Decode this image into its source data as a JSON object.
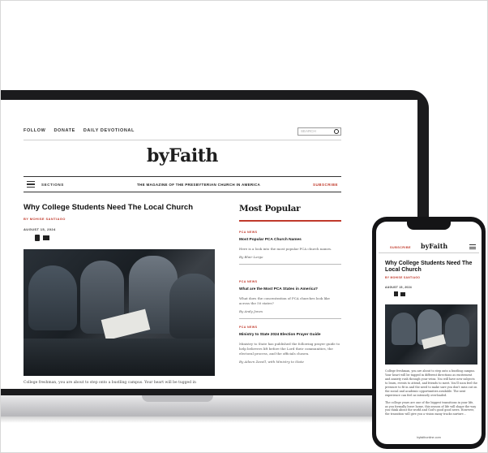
{
  "laptop": {
    "top_links": [
      "FOLLOW",
      "DONATE",
      "DAILY DEVOTIONAL"
    ],
    "search_placeholder": "SEARCH",
    "logo": "byFaith",
    "nav": {
      "sections_label": "SECTIONS",
      "tagline": "THE MAGAZINE OF THE PRESBYTERIAN CHURCH IN AMERICA",
      "subscribe_label": "SUBSCRIBE"
    },
    "article": {
      "title": "Why College Students Need The Local Church",
      "byline": "BY MOHISE SANTIAGO",
      "date": "AUGUST 15, 2024",
      "body_excerpt": "College freshman, you are about to step onto a bustling campus. Your heart will be tugged in"
    },
    "popular": {
      "heading": "Most Popular",
      "items": [
        {
          "tag": "PCA NEWS",
          "title": "Most Popular PCA Church Names",
          "text": "Here is a look into the most popular PCA church names.",
          "author": "By Blair Largo"
        },
        {
          "tag": "PCA NEWS",
          "title": "What are the Most PCA States in America?",
          "text": "What does the concentration of PCA churches look like across the 50 states?",
          "author": "By Andy Jones"
        },
        {
          "tag": "PCA NEWS",
          "title": "Ministry to State 2024 Election Prayer Guide",
          "text": "Ministry to State has published the following prayer guide to help believers lift before the Lord their communities, the electoral process, and the officials chosen.",
          "author": "By Aileen Zavell, with Ministry to State"
        }
      ]
    }
  },
  "phone": {
    "subscribe_label": "SUBSCRIBE",
    "logo": "byFaith",
    "title": "Why College Students Need The Local Church",
    "byline": "BY MOHISE SANTIAGO",
    "date": "AUGUST 15, 2024",
    "paragraph_1": "College freshman, you are about to step onto a bustling campus. Your heart will be tugged in different directions as excitement and anxiety rush through your veins. You will have new subjects to learn, events to attend, and friends to meet. You'll soon feel the pressure to fit in and the need to make sure you don't miss out on the social and academic opportunities available. The next experience can feel as intensely overloaded.",
    "paragraph_2": "The college years are one of the biggest transitions in your life, as you formally leave home, this season of life will shape the way you think about the world and God's good good news. However, the transition will give you a vision many tracks nurture...",
    "url": "byfaithonline.com"
  },
  "icons": [
    "search-icon",
    "menu-icon",
    "facebook-icon",
    "mail-icon"
  ],
  "colors": {
    "accent": "#c0392b",
    "device": "#1b1b1d"
  }
}
